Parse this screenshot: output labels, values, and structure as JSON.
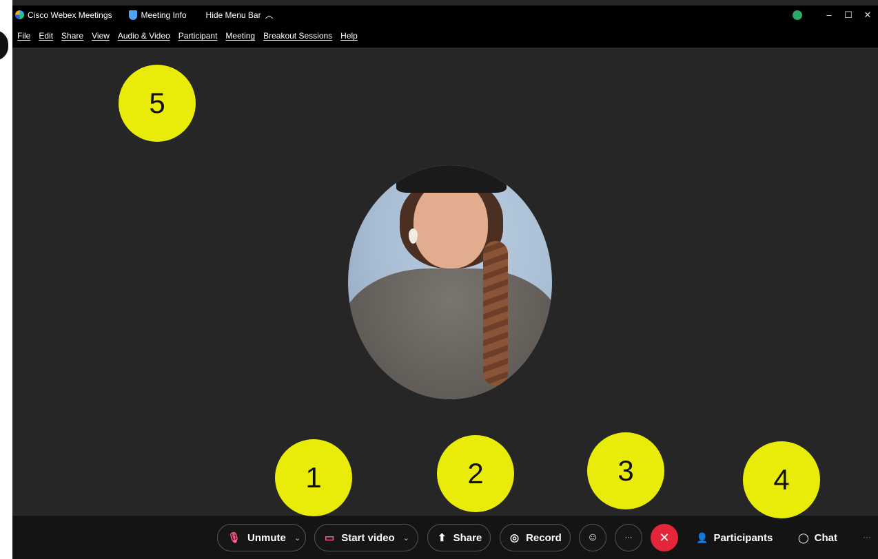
{
  "titlebar": {
    "app_name": "Cisco Webex Meetings",
    "meeting_info": "Meeting Info",
    "hide_menu": "Hide Menu Bar",
    "minimize": "–",
    "maximize": "☐",
    "close": "✕"
  },
  "menu": {
    "items": [
      "File",
      "Edit",
      "Share",
      "View",
      "Audio & Video",
      "Participant",
      "Meeting",
      "Breakout Sessions",
      "Help"
    ]
  },
  "callouts": [
    "1",
    "2",
    "3",
    "4",
    "5"
  ],
  "toolbar": {
    "unmute_label": "Unmute",
    "start_video_label": "Start video",
    "share_label": "Share",
    "record_label": "Record",
    "participants_label": "Participants",
    "chat_label": "Chat",
    "more_label": "···",
    "end_label": "✕"
  },
  "colors": {
    "accent_yellow": "#e9ec08",
    "end_red": "#e3263a",
    "muted_pink": "#ff5c8a",
    "background": "#262626"
  },
  "icons": {
    "mic": "mic-off-icon",
    "video": "video-off-icon",
    "share": "share-screen-icon",
    "record": "record-icon",
    "reactions": "reactions-icon",
    "participants": "participants-icon",
    "chat": "chat-bubble-icon"
  }
}
